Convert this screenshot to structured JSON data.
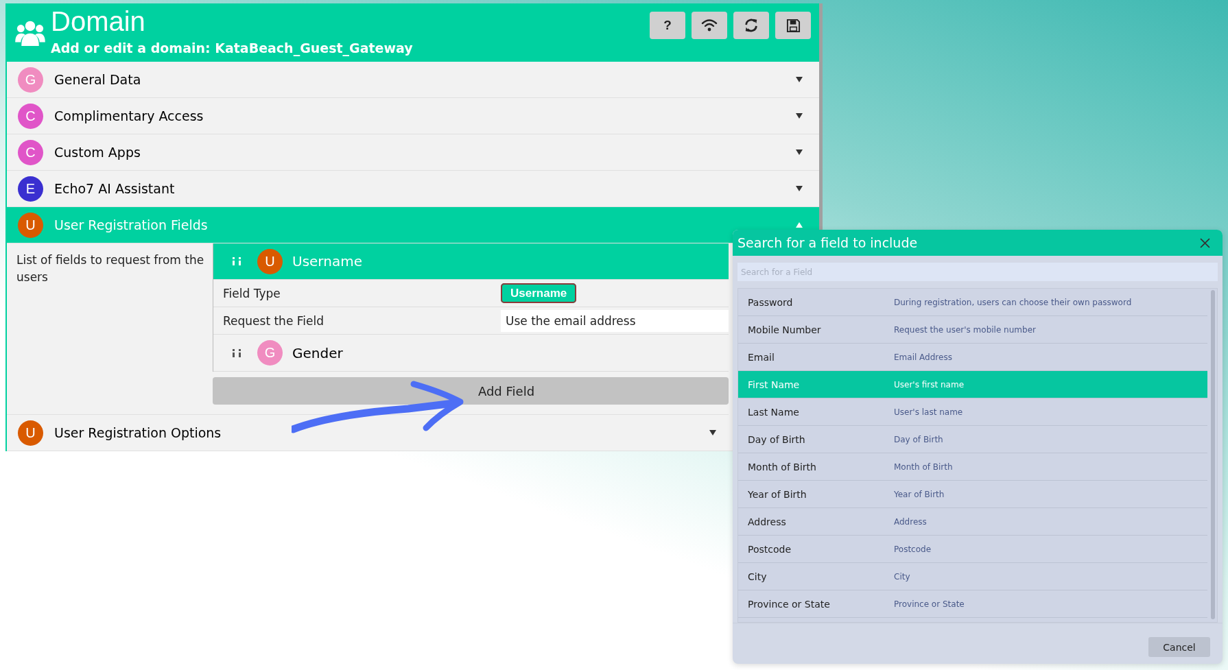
{
  "header": {
    "title": "Domain",
    "subtitle": "Add or edit a domain: KataBeach_Guest_Gateway"
  },
  "toolbar": [
    {
      "kind": "help",
      "label": "?"
    },
    {
      "kind": "wifi"
    },
    {
      "kind": "refresh"
    },
    {
      "kind": "save"
    }
  ],
  "sections": [
    {
      "letter": "G",
      "title": "General Data",
      "color": "#f08cc0",
      "expanded": false
    },
    {
      "letter": "C",
      "title": "Complimentary Access",
      "color": "#e055c8",
      "expanded": false
    },
    {
      "letter": "C",
      "title": "Custom Apps",
      "color": "#e055c8",
      "expanded": false
    },
    {
      "letter": "E",
      "title": "Echo7 AI Assistant",
      "color": "#3a2fd0",
      "expanded": false
    },
    {
      "letter": "U",
      "title": "User Registration Fields",
      "color": "#d95a00",
      "expanded": true
    },
    {
      "letter": "U",
      "title": "User Registration Options",
      "color": "#d95a00",
      "expanded": false
    }
  ],
  "registration_fields": {
    "description": "List of fields to request from the users",
    "fields": [
      {
        "letter": "U",
        "name": "Username",
        "color": "#d95a00",
        "expanded": true,
        "properties": [
          {
            "label": "Field Type",
            "kind": "badge",
            "value": "Username"
          },
          {
            "label": "Request the Field",
            "kind": "text",
            "value": "Use the email address"
          }
        ]
      },
      {
        "letter": "G",
        "name": "Gender",
        "color": "#f08cc0",
        "expanded": false
      }
    ],
    "add_button": "Add Field"
  },
  "dialog": {
    "title": "Search for a field to include",
    "search": {
      "placeholder": "Search for a Field"
    },
    "options": [
      {
        "name": "Password",
        "description": "During registration, users can choose their own password",
        "selected": false
      },
      {
        "name": "Mobile Number",
        "description": "Request the user's mobile number",
        "selected": false
      },
      {
        "name": "Email",
        "description": "Email Address",
        "selected": false
      },
      {
        "name": "First Name",
        "description": "User's first name",
        "selected": true
      },
      {
        "name": "Last Name",
        "description": "User's last name",
        "selected": false
      },
      {
        "name": "Day of Birth",
        "description": "Day of Birth",
        "selected": false
      },
      {
        "name": "Month of Birth",
        "description": "Month of Birth",
        "selected": false
      },
      {
        "name": "Year of Birth",
        "description": "Year of Birth",
        "selected": false
      },
      {
        "name": "Address",
        "description": "Address",
        "selected": false
      },
      {
        "name": "Postcode",
        "description": "Postcode",
        "selected": false
      },
      {
        "name": "City",
        "description": "City",
        "selected": false
      },
      {
        "name": "Province or State",
        "description": "Province or State",
        "selected": false
      }
    ],
    "cancel": "Cancel"
  }
}
